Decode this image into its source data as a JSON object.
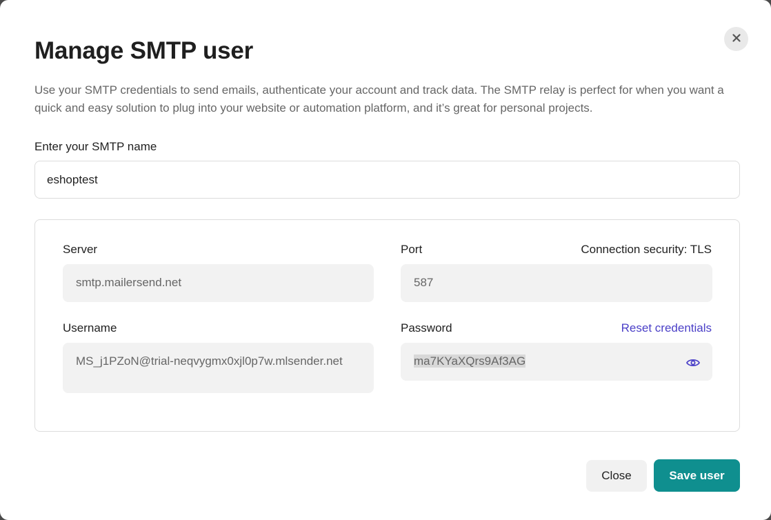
{
  "dialog": {
    "title": "Manage SMTP user",
    "description": "Use your SMTP credentials to send emails, authenticate your account and track data. The SMTP relay is perfect for when you want a quick and easy solution to plug into your website or automation platform, and it’s great for personal projects.",
    "close_icon": "close-icon"
  },
  "smtp_name": {
    "label": "Enter your SMTP name",
    "value": "eshoptest",
    "placeholder": ""
  },
  "credentials": {
    "server_label": "Server",
    "server_value": "smtp.mailersend.net",
    "port_label": "Port",
    "port_value": "587",
    "security_label": "Connection security: TLS",
    "username_label": "Username",
    "username_value": "MS_j1PZoN@trial-neqvygmx0xjl0p7w.mlsender.net",
    "password_label": "Password",
    "password_value": "ma7KYaXQrs9Af3AG",
    "reset_label": "Reset credentials",
    "eye_icon": "eye-icon"
  },
  "footer": {
    "close_label": "Close",
    "save_label": "Save user"
  },
  "colors": {
    "accent": "#0f8f8f",
    "link": "#4a3fc7",
    "field_bg": "#f2f2f2"
  }
}
